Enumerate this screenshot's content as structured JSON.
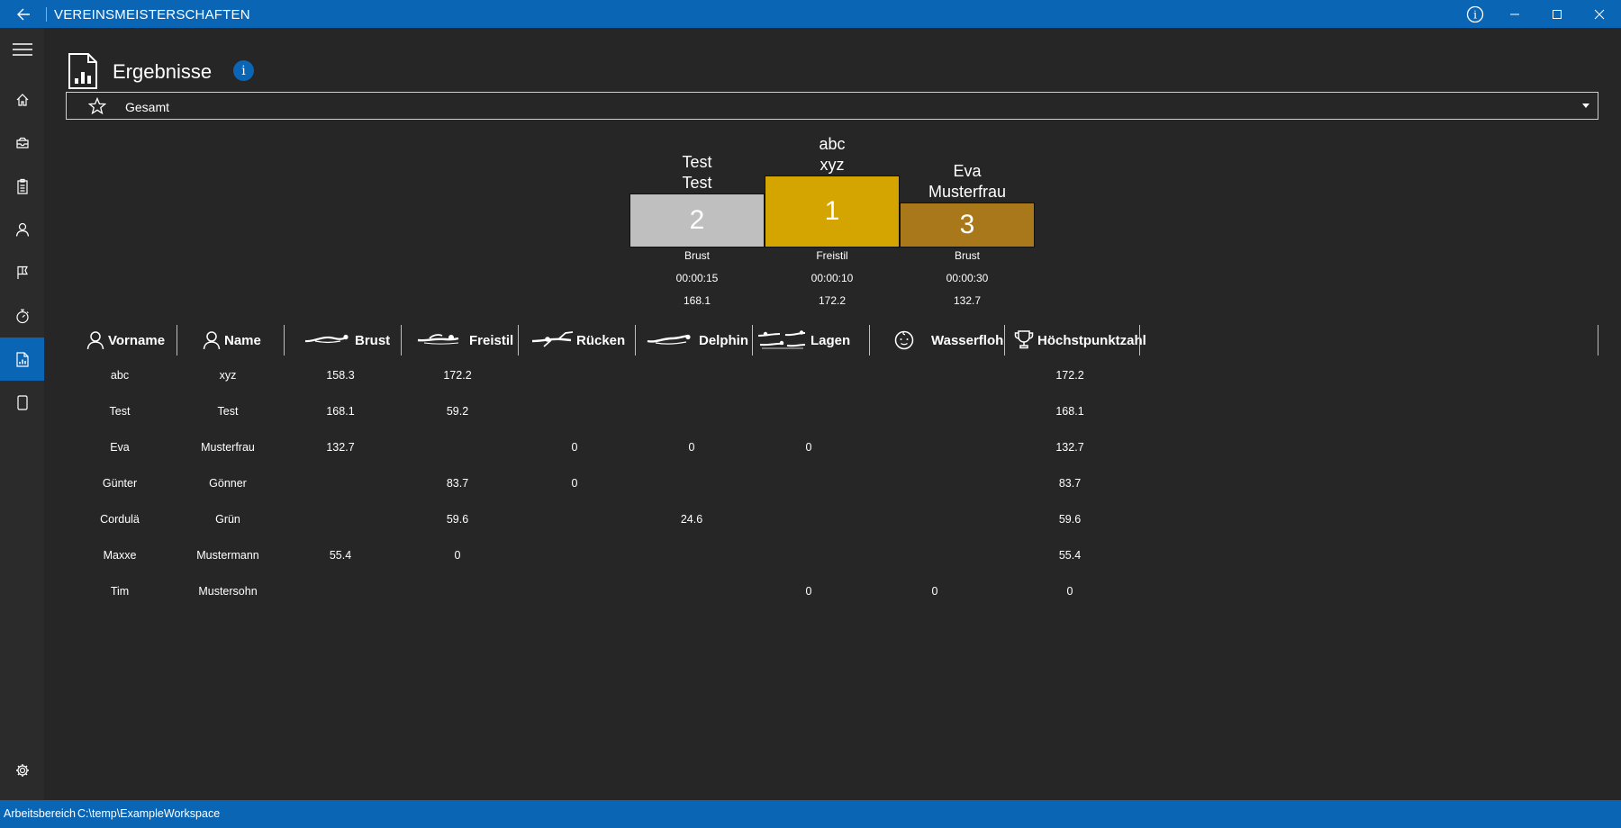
{
  "window": {
    "title": "VEREINSMEISTERSCHAFTEN",
    "info_glyph": "i"
  },
  "sidebar": {
    "items": [
      "menu-icon",
      "home-icon",
      "inbox-icon",
      "clipboard-icon",
      "person-icon",
      "flag-icon",
      "stopwatch-icon",
      "report-icon",
      "document-icon",
      "gear-icon"
    ],
    "active": "report-icon"
  },
  "page": {
    "title": "Ergebnisse",
    "info_glyph": "i"
  },
  "filter": {
    "selected": "Gesamt",
    "icon": "star-icon"
  },
  "podium": {
    "colors": {
      "first": "#d4a400",
      "second": "#bfbfbf",
      "third": "#a8781a"
    },
    "places": [
      {
        "rank": "2",
        "first_name": "Test",
        "last_name": "Test",
        "style": "Brust",
        "time": "00:00:15",
        "points": "168.1"
      },
      {
        "rank": "1",
        "first_name": "abc",
        "last_name": "xyz",
        "style": "Freistil",
        "time": "00:00:10",
        "points": "172.2"
      },
      {
        "rank": "3",
        "first_name": "Eva",
        "last_name": "Musterfrau",
        "style": "Brust",
        "time": "00:00:30",
        "points": "132.7"
      }
    ]
  },
  "table": {
    "columns": [
      "Vorname",
      "Name",
      "Brust",
      "Freistil",
      "Rücken",
      "Delphin",
      "Lagen",
      "Wasserfloh",
      "Höchstpunktzahl"
    ],
    "rows": [
      [
        "abc",
        "xyz",
        "158.3",
        "172.2",
        "",
        "",
        "",
        "",
        "172.2"
      ],
      [
        "Test",
        "Test",
        "168.1",
        "59.2",
        "",
        "",
        "",
        "",
        "168.1"
      ],
      [
        "Eva",
        "Musterfrau",
        "132.7",
        "",
        "0",
        "0",
        "0",
        "",
        "132.7"
      ],
      [
        "Günter",
        "Gönner",
        "",
        "83.7",
        "0",
        "",
        "",
        "",
        "83.7"
      ],
      [
        "Cordulä",
        "Grün",
        "",
        "59.6",
        "",
        "24.6",
        "",
        "",
        "59.6"
      ],
      [
        "Maxxe",
        "Mustermann",
        "55.4",
        "0",
        "",
        "",
        "",
        "",
        "55.4"
      ],
      [
        "Tim",
        "Mustersohn",
        "",
        "",
        "",
        "",
        "0",
        "0",
        "0"
      ]
    ]
  },
  "status": {
    "label": "Arbeitsbereich",
    "path": "C:\\temp\\ExampleWorkspace"
  }
}
